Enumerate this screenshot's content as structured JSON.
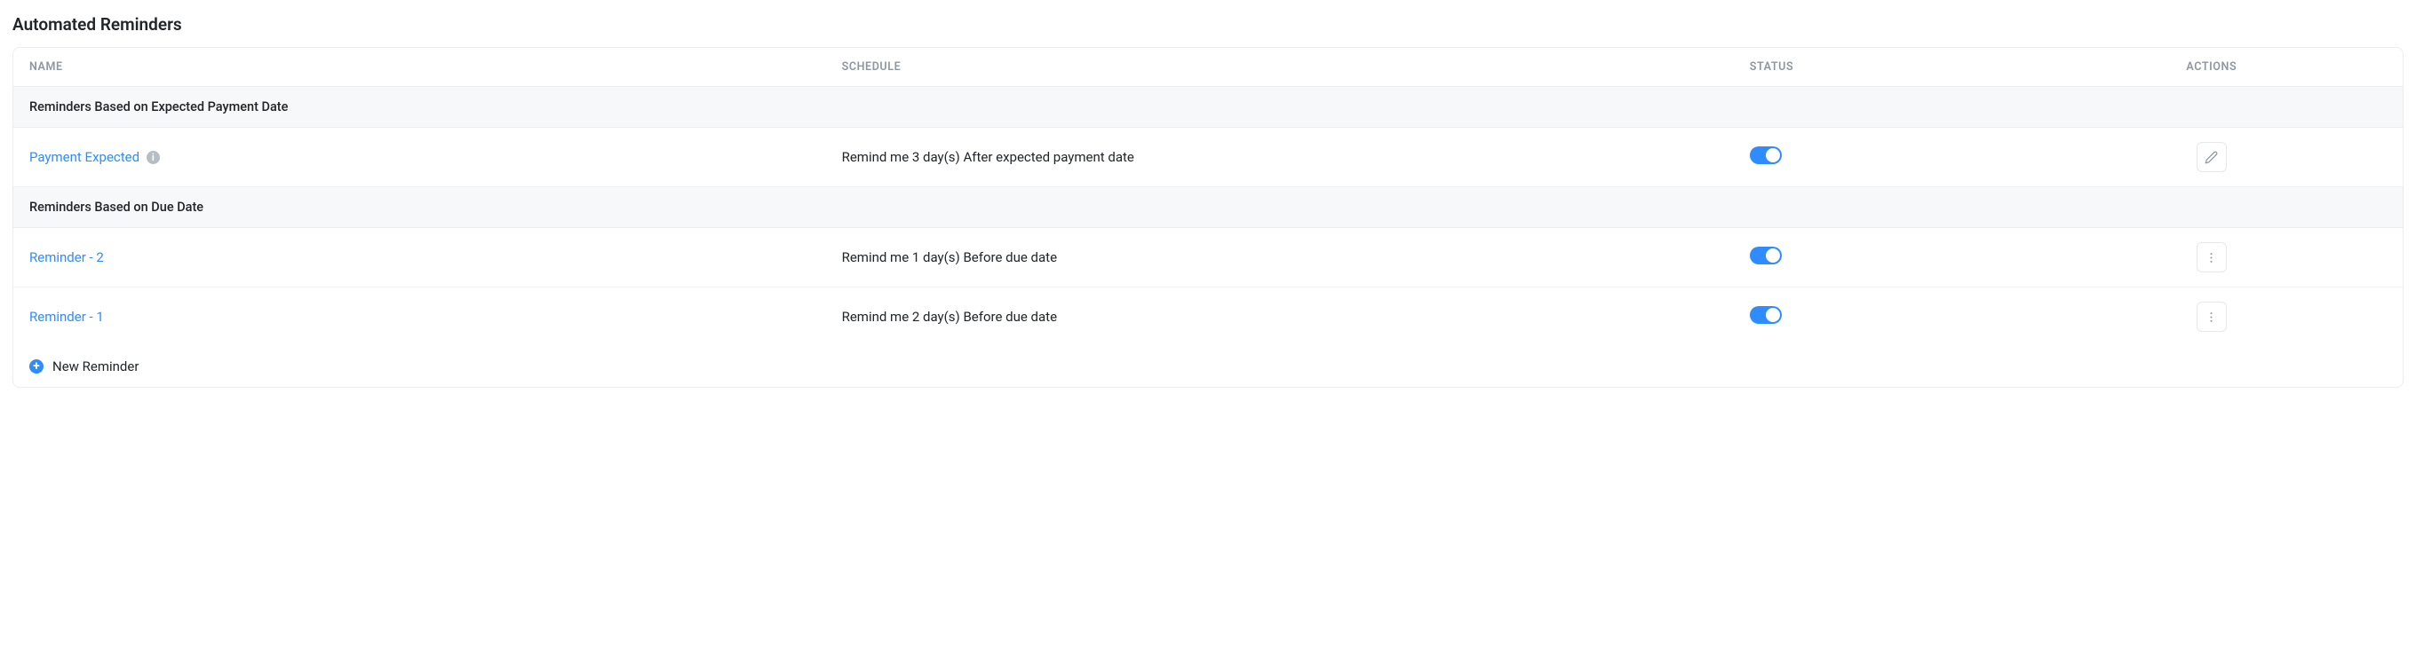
{
  "title": "Automated Reminders",
  "table": {
    "headers": {
      "name": "NAME",
      "schedule": "SCHEDULE",
      "status": "STATUS",
      "actions": "ACTIONS"
    },
    "groups": [
      {
        "label": "Reminders Based on Expected Payment Date",
        "rows": [
          {
            "name": "Payment Expected",
            "info": true,
            "schedule": "Remind me 3 day(s) After expected payment date",
            "enabled": true,
            "action": "edit"
          }
        ]
      },
      {
        "label": "Reminders Based on Due Date",
        "rows": [
          {
            "name": "Reminder - 2",
            "info": false,
            "schedule": "Remind me 1 day(s) Before due date",
            "enabled": true,
            "action": "more"
          },
          {
            "name": "Reminder - 1",
            "info": false,
            "schedule": "Remind me 2 day(s) Before due date",
            "enabled": true,
            "action": "more"
          }
        ]
      }
    ]
  },
  "footer": {
    "new_label": "New Reminder"
  }
}
